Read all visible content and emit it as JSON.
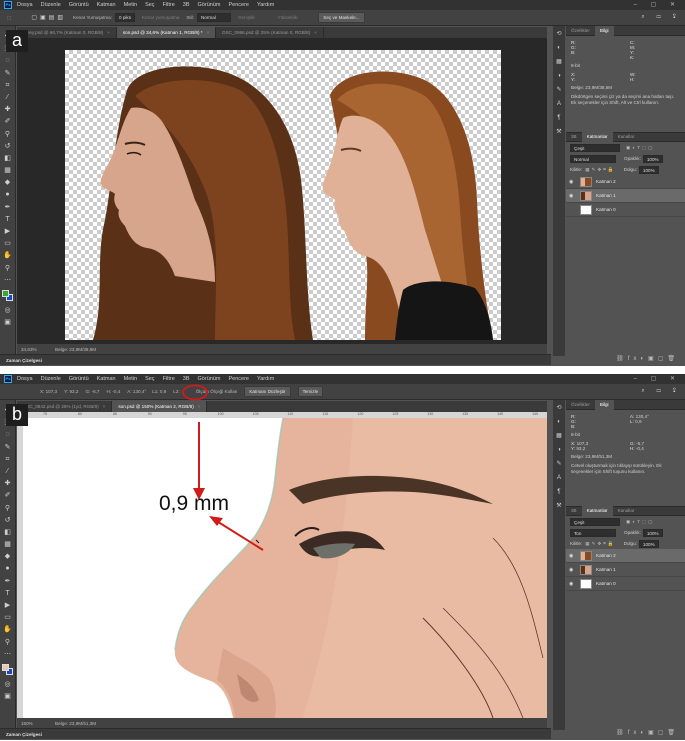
{
  "menu": [
    "Dosya",
    "Düzenle",
    "Görüntü",
    "Katman",
    "Metin",
    "Seç",
    "Filtre",
    "3B",
    "Görünüm",
    "Pencere",
    "Yardım"
  ],
  "app_icon": "Ps",
  "window_controls": "– ▢ ✕",
  "panel_a": {
    "label": "a",
    "options": {
      "feather_label": "Kenar Yumuşatma:",
      "feather_value": "0 piks",
      "antialias": "Kenar yumuşatma",
      "style_label": "Stil:",
      "style_value": "Normal",
      "width_label": "Genişlik:",
      "height_label": "Yükseklik:",
      "button": "Seç ve Maskele..."
    },
    "tabs": [
      {
        "title": "...ney.psd @ 66,7% (Katman 0, RGB/8)",
        "active": false
      },
      {
        "title": "son.psd @ 34,6% (Katman 1, RGB/8) *",
        "active": true
      },
      {
        "title": "DSC_0966.psd @ 25% (Katman 0, RGB/8)",
        "active": false
      }
    ],
    "status_zoom": "34,63%",
    "status_doc": "Belge: 23,9M/38,6M",
    "timeline": "Zaman Çizelgesi",
    "info_tabs": [
      "Özellikler",
      "Bilgi"
    ],
    "info": {
      "r_label": "R:",
      "g_label": "G:",
      "b_label": "B:",
      "bit": "8-bit",
      "c_label": "C:",
      "m_label": "M:",
      "y_label": "Y:",
      "k_label": "K:",
      "x_label": "X:",
      "y2_label": "Y:",
      "w_label": "W:",
      "h_label": "H:",
      "doc": "Belge: 23,9M/38,6M",
      "desc": "Dikdörtgen seçimi çiz ya da seçimi ana hatları taşı. Ek seçenekler için Shift, Alt ve Ctrl kullanın."
    },
    "layers_tabs": [
      "3B",
      "Katmanlar",
      "Kanallar"
    ],
    "layers_filter": "Çeşit",
    "blend": "Normal",
    "opacity_label": "Opaklık:",
    "opacity_value": "100%",
    "lock_label": "Kilitle:",
    "fill_label": "Dolgu:",
    "fill_value": "100%",
    "layers": [
      {
        "name": "Katman 2",
        "selected": false,
        "visible": true
      },
      {
        "name": "Katman 1",
        "selected": true,
        "visible": true
      },
      {
        "name": "Katman 0",
        "selected": false,
        "visible": false
      }
    ]
  },
  "panel_b": {
    "label": "b",
    "options": {
      "x": "X: 107,3",
      "y": "Y: 93,2",
      "w": "G: -6,7",
      "h": "H: -0,4",
      "angle": "A: 130,4°",
      "l1": "L1: 0,9",
      "l2": "L2:",
      "scale_check": "Ölçüm Ölçeği Kullan",
      "straighten": "Katmanı Düzleştir",
      "clear": "Temizle"
    },
    "tabs": [
      {
        "title": "DSC_0842.psd @ 25% (1yd, RGB/8)",
        "active": false
      },
      {
        "title": "son.psd @ 150% (Katman 2, RGB/8)",
        "active": true
      }
    ],
    "ruler_ticks": [
      "75",
      "80",
      "85",
      "90",
      "95",
      "100",
      "105",
      "110",
      "115",
      "120",
      "125",
      "130",
      "135",
      "140",
      "145"
    ],
    "status_zoom": "150%",
    "status_doc": "Belge: 23,9M/51,3M",
    "timeline": "Zaman Çizelgesi",
    "info_tabs": [
      "Özellikler",
      "Bilgi"
    ],
    "info": {
      "r_label": "R:",
      "g_label": "G:",
      "b_label": "B:",
      "bit": "8-bit",
      "a_label": "A:",
      "a_value": "130,4°",
      "l_label": "L:",
      "l_value": "0,9",
      "x_label": "X:",
      "x_value": "107,3",
      "y_label": "Y:",
      "y_value": "93,2",
      "w_label": "G:",
      "w_value": "-6,7",
      "h_label": "H:",
      "h_value": "-0,4",
      "doc": "Belge: 23,9M/51,3M",
      "desc": "Cetvel oluşturmak için tıklayıp sürükleyin. Ek seçenekler için Shift tuşunu kullanın."
    },
    "layers_tabs": [
      "3B",
      "Katmanlar",
      "Kanallar"
    ],
    "layers_filter": "Çeşit",
    "blend": "Ton",
    "opacity_label": "Opaklık:",
    "opacity_value": "100%",
    "lock_label": "Kilitle:",
    "fill_label": "Dolgu:",
    "fill_value": "100%",
    "layers": [
      {
        "name": "Katman 2",
        "selected": true,
        "visible": true
      },
      {
        "name": "Katman 1",
        "selected": false,
        "visible": true
      },
      {
        "name": "Katman 0",
        "selected": false,
        "visible": true
      }
    ],
    "measurement": "0,9 mm"
  },
  "colors": {
    "ps_bg": "#535353",
    "fg_swatch_a": "#2fae2a",
    "bg_swatch_a": "#1d49c8",
    "fg_swatch_b": "#e7c6b3",
    "bg_swatch_b": "#1d49c8",
    "annotation_red": "#d11a1a"
  }
}
